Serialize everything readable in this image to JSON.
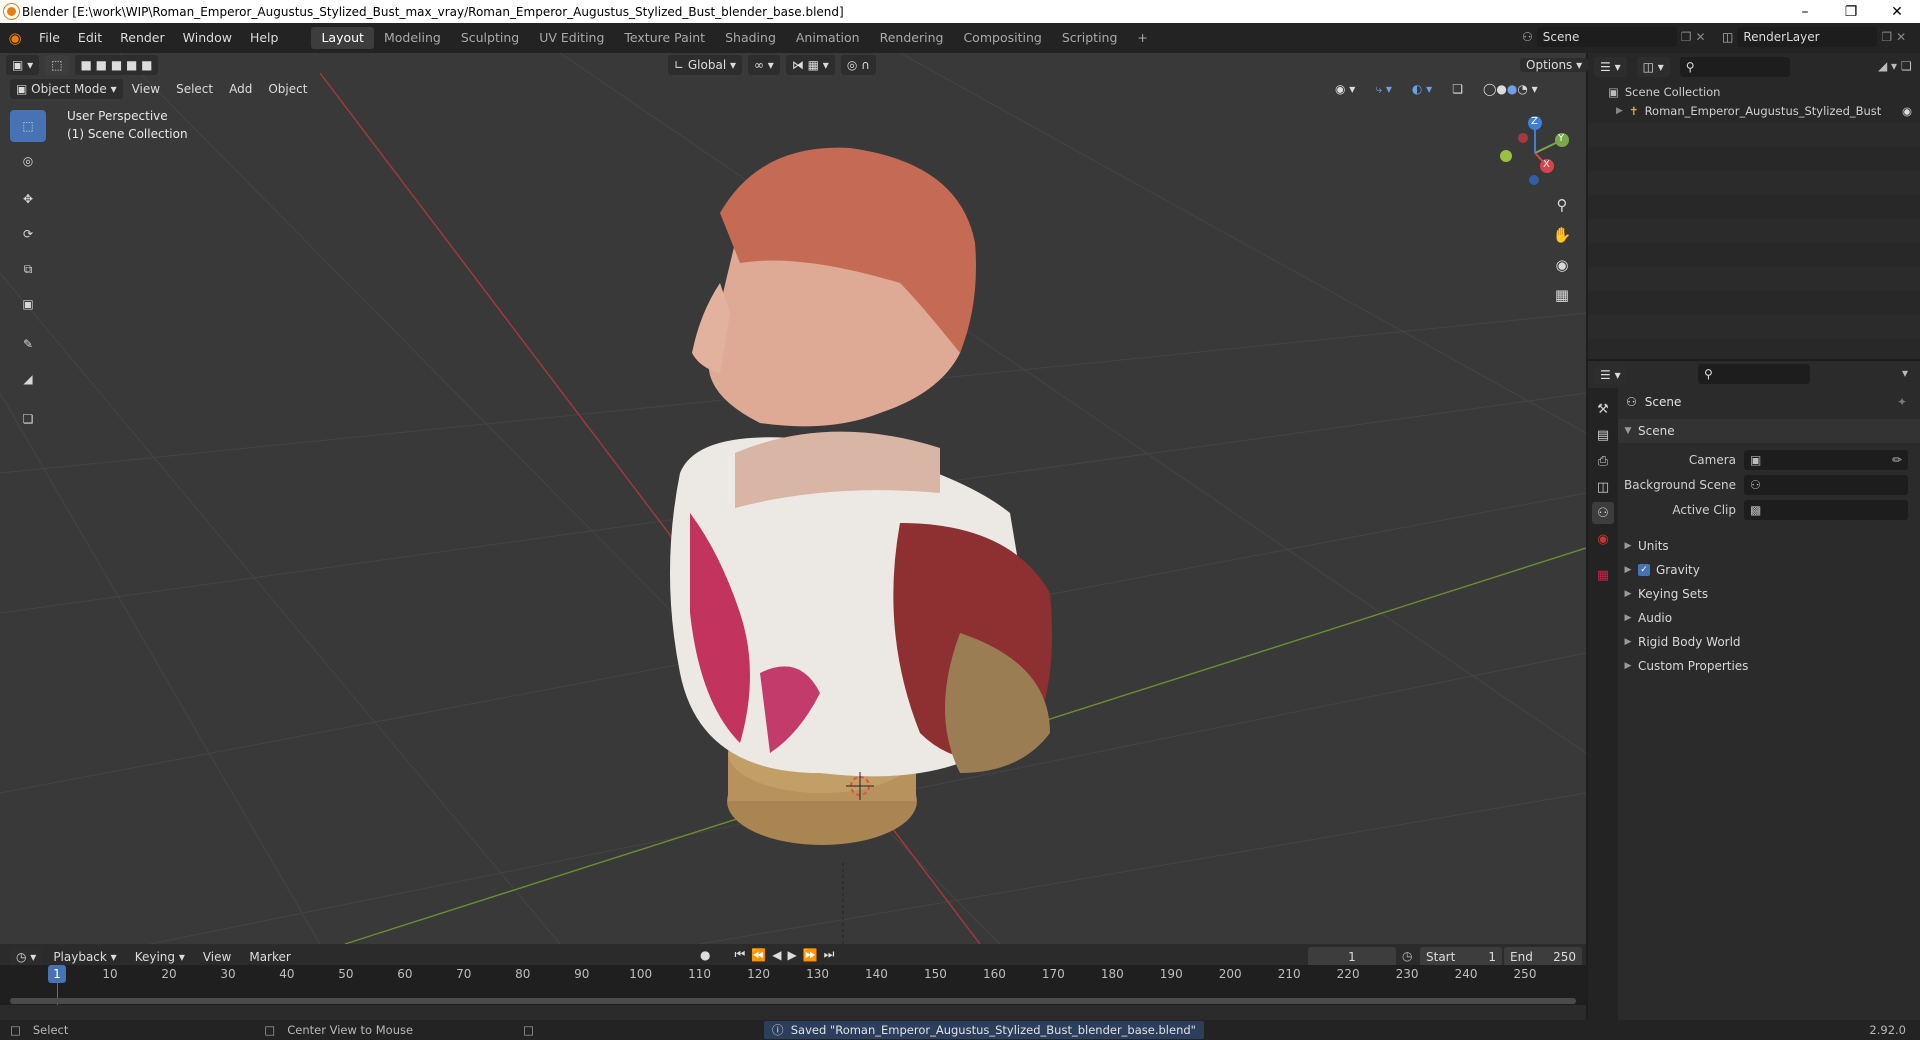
{
  "window": {
    "title": "Blender [E:\\work\\WIP\\Roman_Emperor_Augustus_Stylized_Bust_max_vray/Roman_Emperor_Augustus_Stylized_Bust_blender_base.blend]"
  },
  "menus": [
    "File",
    "Edit",
    "Render",
    "Window",
    "Help"
  ],
  "workspaces": [
    "Layout",
    "Modeling",
    "Sculpting",
    "UV Editing",
    "Texture Paint",
    "Shading",
    "Animation",
    "Rendering",
    "Compositing",
    "Scripting"
  ],
  "active_workspace": "Layout",
  "scene_field": "Scene",
  "render_layer_field": "RenderLayer",
  "viewport": {
    "transform_orientation": "Global",
    "options_label": "Options",
    "mode": "Object Mode",
    "menu": [
      "View",
      "Select",
      "Add",
      "Object"
    ],
    "overlay_title": "User Perspective",
    "overlay_subtitle": "(1) Scene Collection",
    "gizmo": {
      "z": "Z",
      "y": "Y",
      "x": "X"
    }
  },
  "outliner": {
    "root": "Scene Collection",
    "items": [
      "Roman_Emperor_Augustus_Stylized_Bust"
    ]
  },
  "properties": {
    "header_title": "Scene",
    "panel_title": "Scene",
    "fields": [
      {
        "label": "Camera",
        "value": ""
      },
      {
        "label": "Background Scene",
        "value": ""
      },
      {
        "label": "Active Clip",
        "value": ""
      }
    ],
    "subpanels": [
      "Units",
      "Gravity",
      "Keying Sets",
      "Audio",
      "Rigid Body World",
      "Custom Properties"
    ],
    "gravity_checked": true
  },
  "timeline": {
    "menus": [
      "Playback",
      "Keying",
      "View",
      "Marker"
    ],
    "current_frame": "1",
    "start_label": "Start",
    "start_value": "1",
    "end_label": "End",
    "end_value": "250",
    "ruler_marks": [
      "1",
      "10",
      "20",
      "30",
      "40",
      "50",
      "60",
      "70",
      "80",
      "90",
      "100",
      "110",
      "120",
      "130",
      "140",
      "150",
      "160",
      "170",
      "180",
      "190",
      "200",
      "210",
      "220",
      "230",
      "240",
      "250"
    ]
  },
  "statusbar": {
    "left_hint": "Select",
    "middle_hint": "Center View to Mouse",
    "message": "Saved \"Roman_Emperor_Augustus_Stylized_Bust_blender_base.blend\"",
    "version": "2.92.0"
  },
  "colors": {
    "accent": "#4772b3",
    "x_axis": "#d8444c",
    "y_axis": "#7ba84b",
    "z_axis": "#3f7fd8"
  }
}
